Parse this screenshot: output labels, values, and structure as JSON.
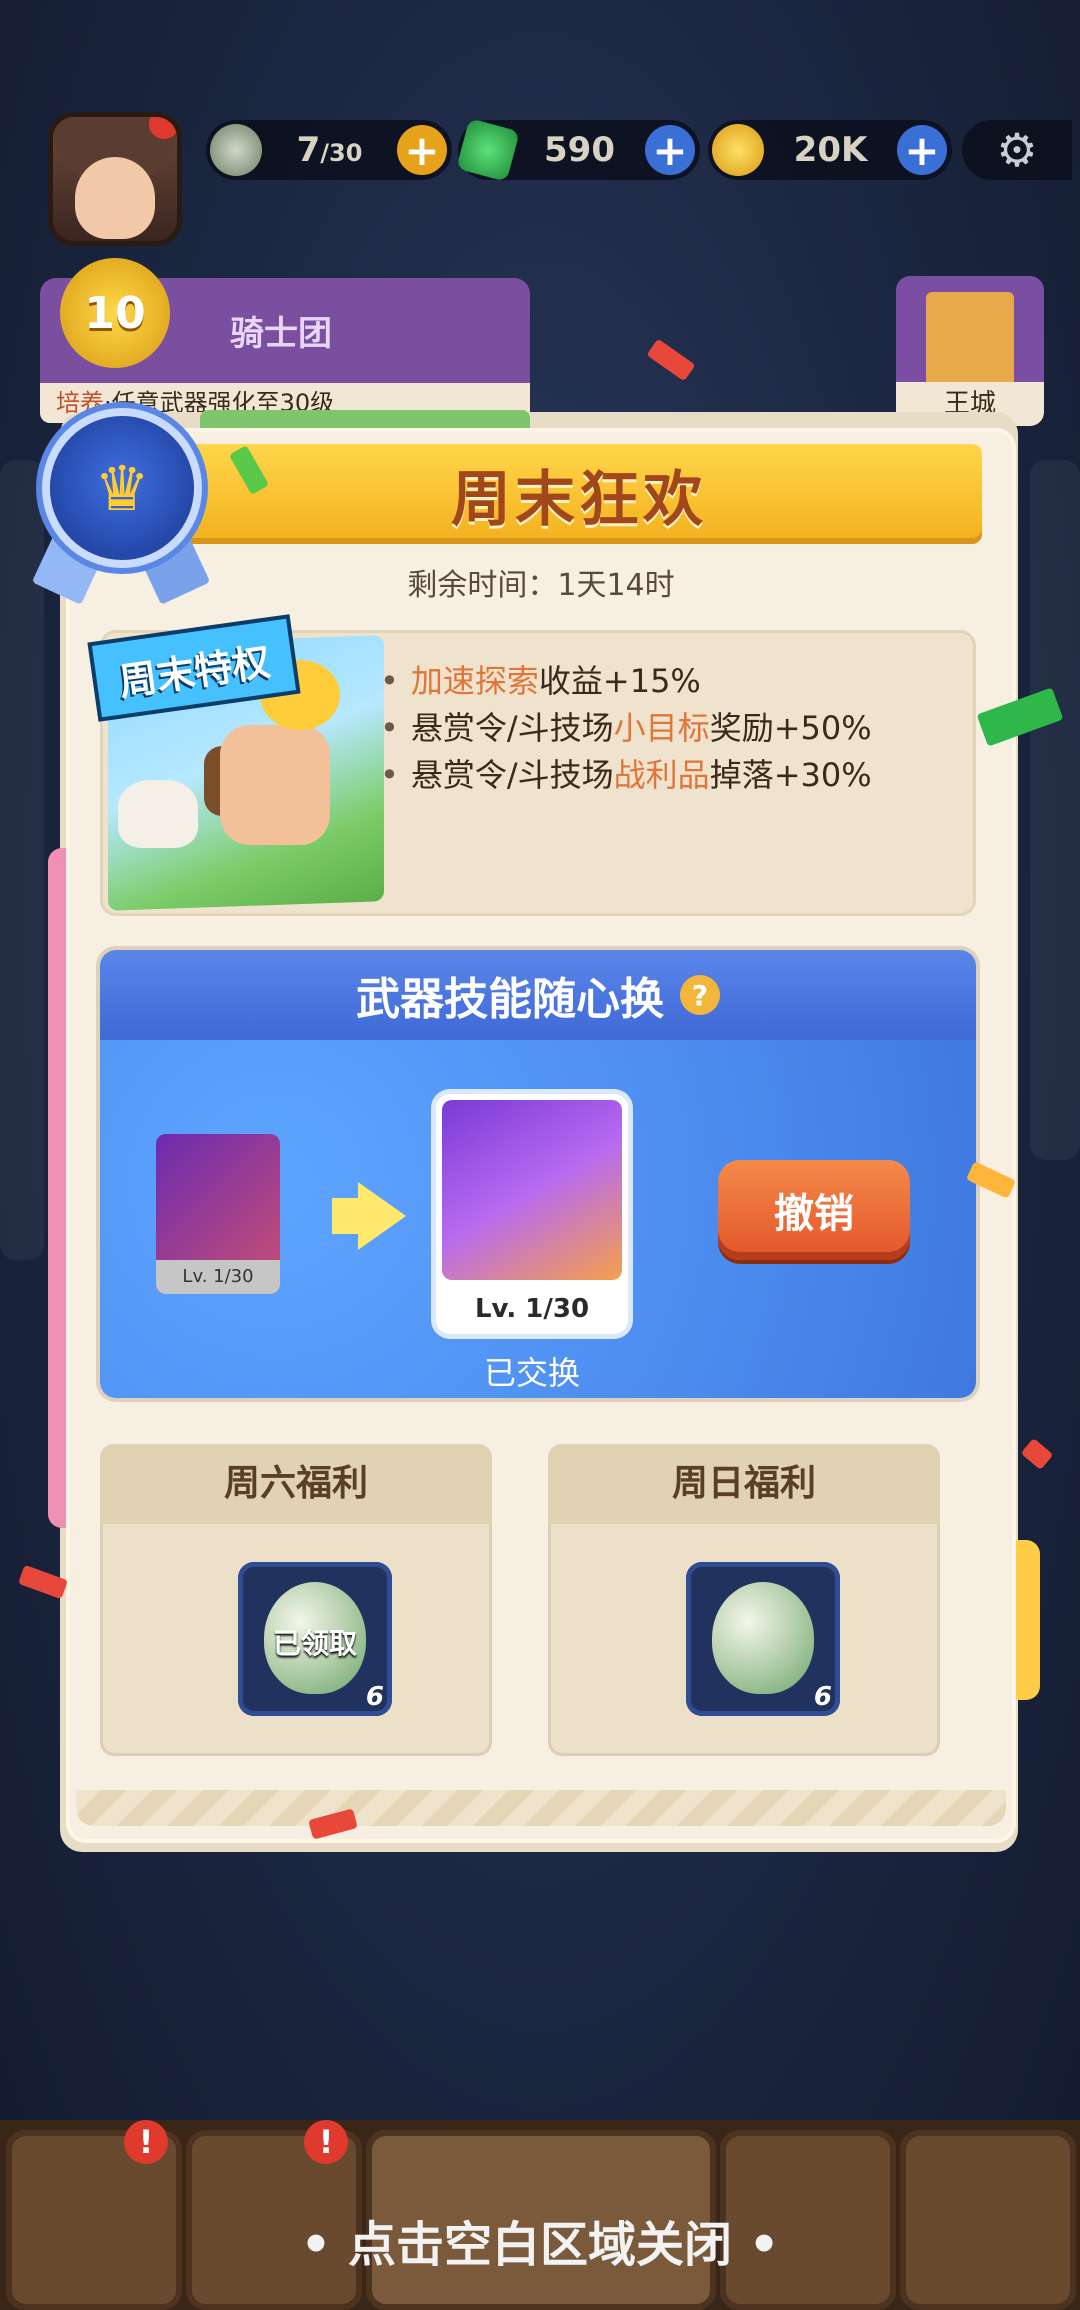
{
  "hud": {
    "energy": {
      "value": "7",
      "max": "/30",
      "icon": "stone-icon"
    },
    "gems": {
      "value": "590",
      "icon": "gem-icon"
    },
    "coins": {
      "value": "20K",
      "icon": "coin-icon"
    },
    "plus": "+",
    "settings_icon": "⚙"
  },
  "knight_group": {
    "level": "10",
    "name": "骑士团",
    "task_prefix": "培养",
    "task": "·任意武器强化至30级"
  },
  "castle": {
    "label": "王城"
  },
  "panel": {
    "title": "周末狂欢",
    "timer": "剩余时间：1天14时",
    "badge_icon": "♛",
    "perk_tag": "周末特权",
    "perks": [
      {
        "bullet": "•",
        "hl": "加速探索",
        "rest": "收益+15%"
      },
      {
        "bullet": "•",
        "pre": "悬赏令/斗技场",
        "hl": "小目标",
        "rest": "奖励+50%"
      },
      {
        "bullet": "•",
        "pre": "悬赏令/斗技场",
        "hl": "战利品",
        "rest": "掉落+30%"
      }
    ],
    "swap": {
      "title": "武器技能随心换",
      "help_icon": "?",
      "old_level": "Lv. 1/30",
      "new_level": "Lv. 1/30",
      "swapped_label": "已交换",
      "undo_label": "撤销"
    },
    "saturday": {
      "title": "周六福利",
      "count": "6",
      "status": "已领取"
    },
    "sunday": {
      "title": "周日福利",
      "count": "6"
    }
  },
  "close_hint": "点击空白区域关闭",
  "hint_dot": "•",
  "alert": "!"
}
